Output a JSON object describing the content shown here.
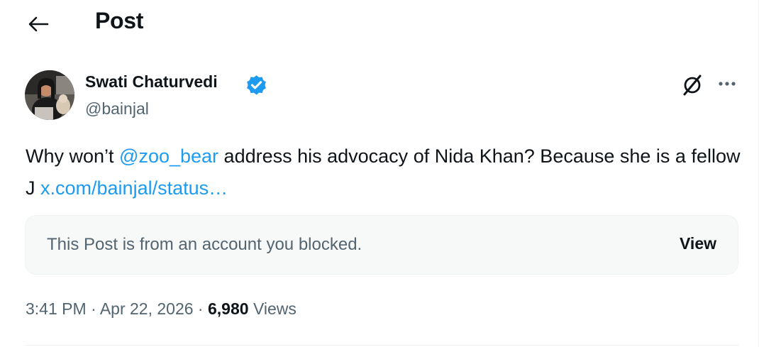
{
  "header": {
    "title": "Post",
    "back_icon": "arrow-left-icon"
  },
  "author": {
    "name": "Swati Chaturvedi",
    "handle": "@bainjal",
    "verified_color": "#1d9bf0"
  },
  "actions": {
    "grok_icon": "grok-icon",
    "more_icon": "more-horizontal-icon"
  },
  "tweet": {
    "text_1": "Why won’t ",
    "mention": "@zoo_bear",
    "text_2": " address his advocacy of Nida Khan? Because she is a fellow J ",
    "link": "x.com/bainjal/status…"
  },
  "blocked_card": {
    "message": "This Post is from an account you blocked.",
    "view_label": "View"
  },
  "meta": {
    "time": "3:41 PM",
    "sep_1": " · ",
    "date": "Apr 22, 2026",
    "sep_2": " · ",
    "views_count": "6,980",
    "views_label": " Views"
  },
  "colors": {
    "accent": "#1d9bf0",
    "text": "#0f1419",
    "secondary": "#536471",
    "card_bg": "#f7f9f9"
  }
}
